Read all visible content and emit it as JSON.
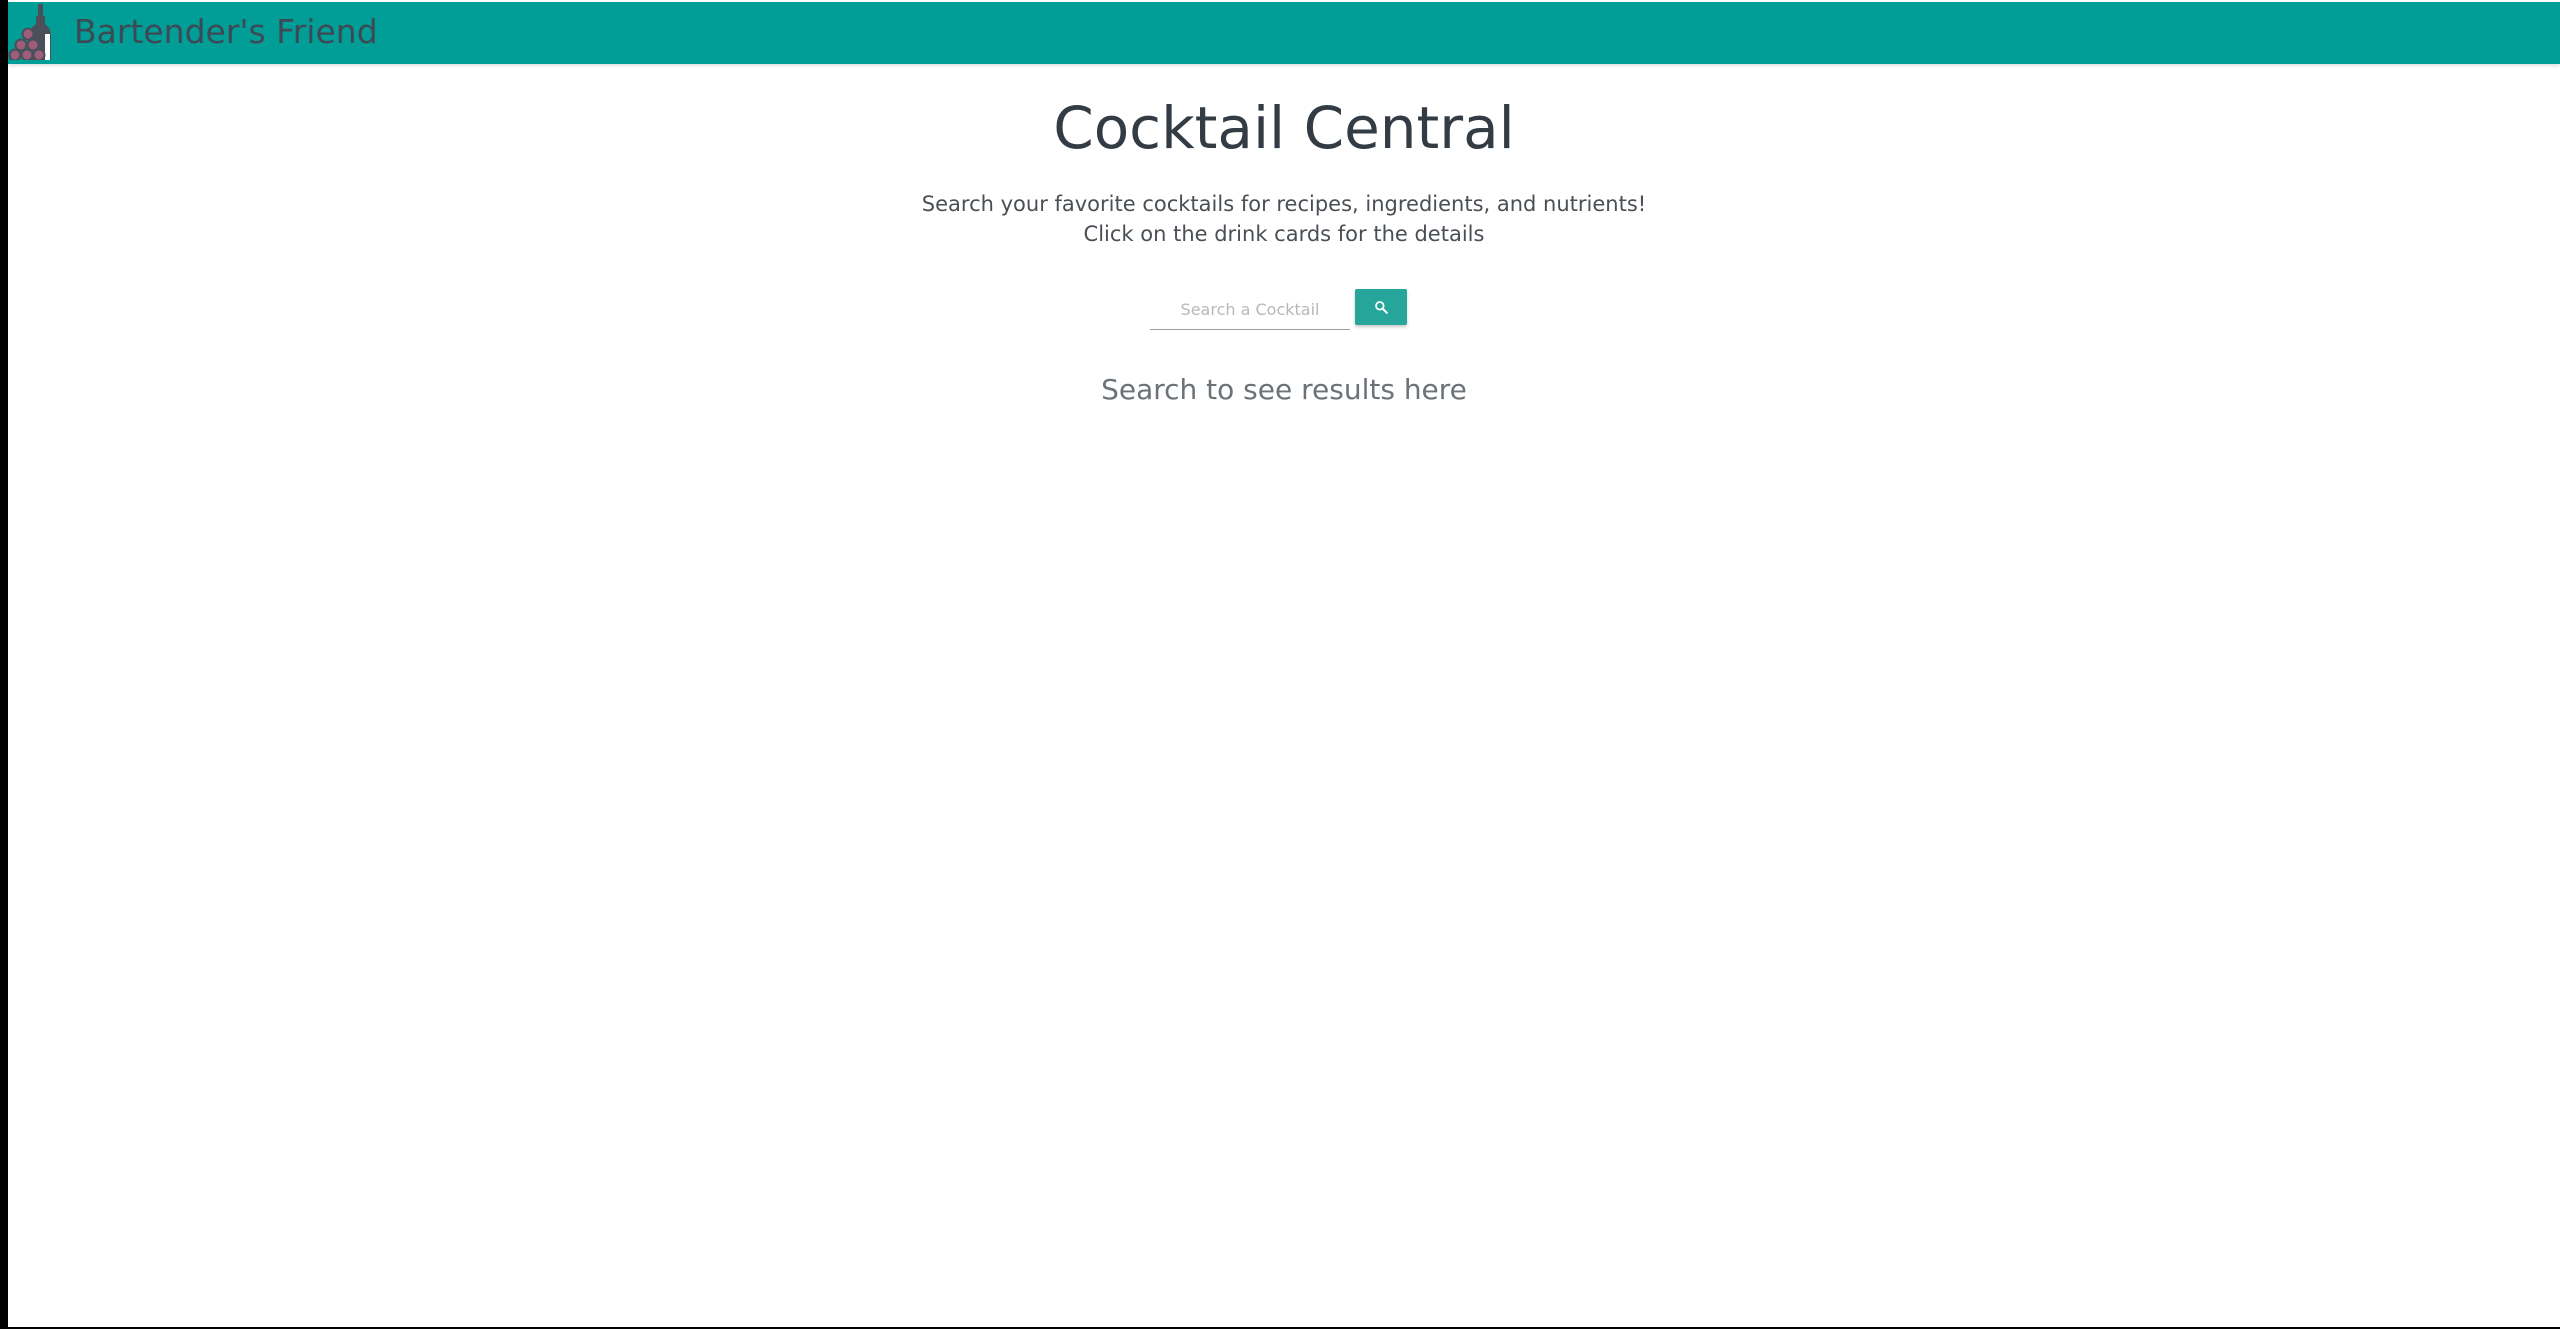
{
  "navbar": {
    "brand": "Bartender's Friend",
    "logo_icon": "bottle-and-glasses-icon",
    "background_color": "#009e96"
  },
  "hero": {
    "title": "Cocktail Central",
    "subtitle_line1": "Search your favorite cocktails for recipes, ingredients, and nutrients!",
    "subtitle_line2": "Click on the drink cards for the details"
  },
  "search": {
    "placeholder": "Search a Cocktail",
    "value": "",
    "button_icon": "search-icon",
    "button_color": "#26a69a"
  },
  "results": {
    "placeholder": "Search to see results here"
  }
}
